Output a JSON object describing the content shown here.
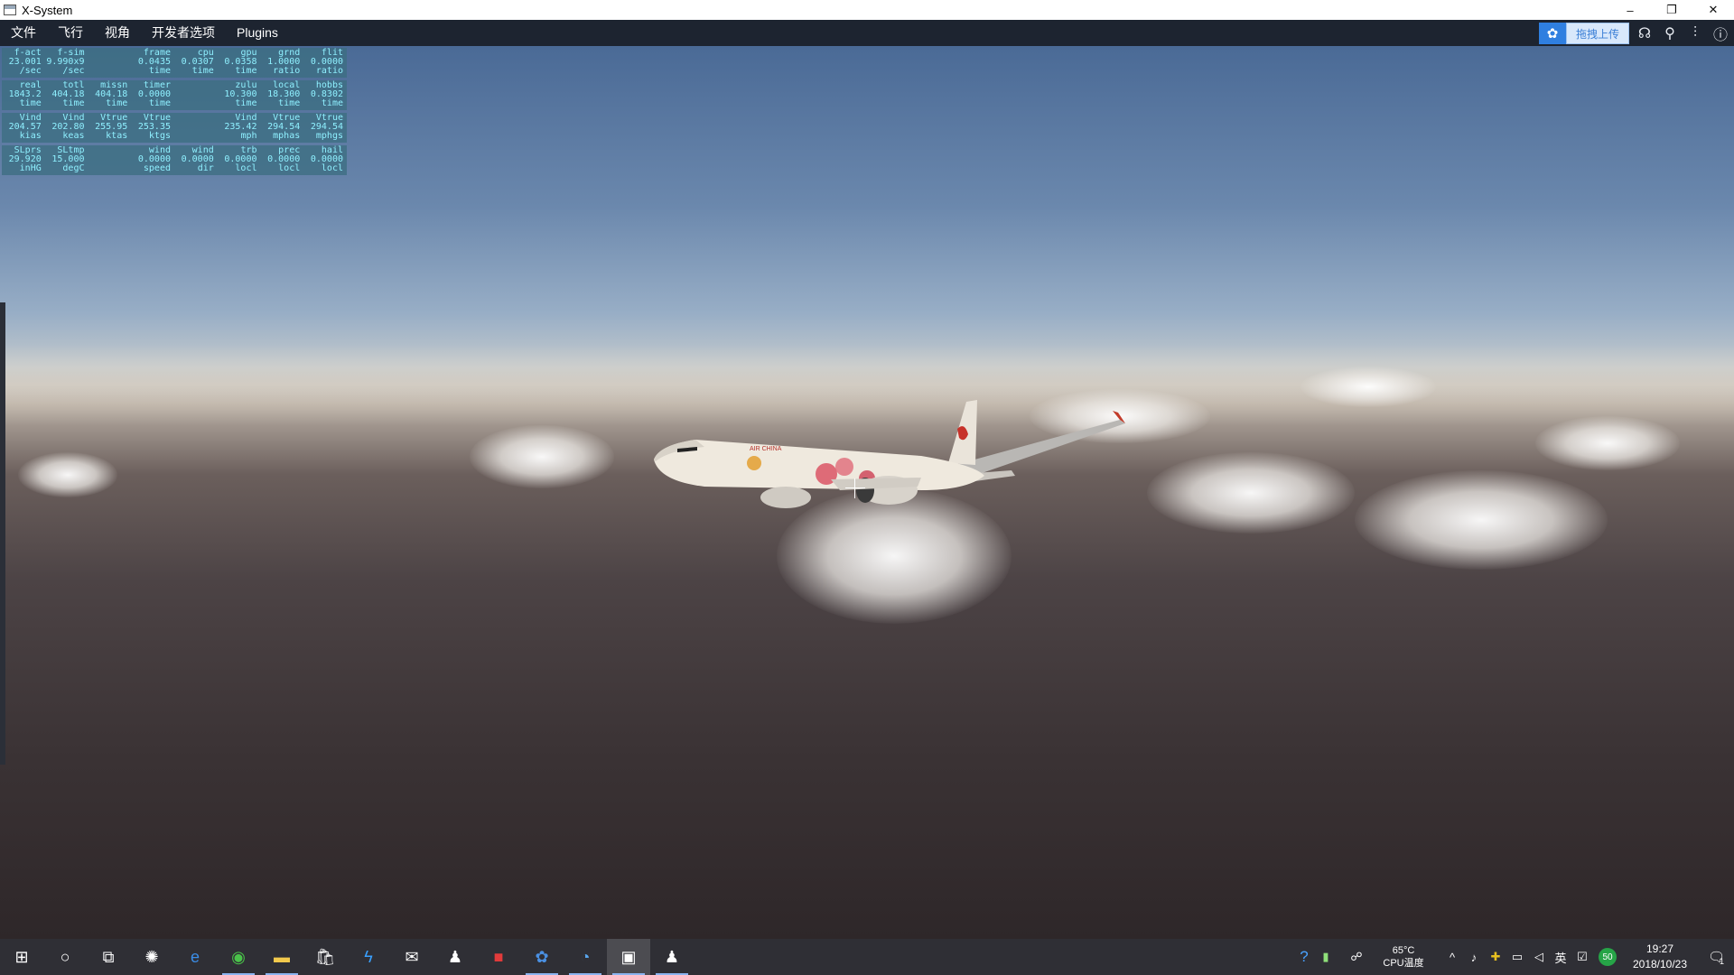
{
  "window": {
    "title": "X-System",
    "minimize": "–",
    "restore": "❐",
    "close": "✕"
  },
  "menu": {
    "items": [
      "文件",
      "飞行",
      "视角",
      "开发者选项",
      "Plugins"
    ]
  },
  "toolbar": {
    "upload_label": "拖拽上传"
  },
  "data_output": {
    "rows": [
      [
        [
          "f-act",
          "23.001",
          "/sec"
        ],
        [
          "f-sim",
          "9.990x9",
          "/sec"
        ],
        [
          "",
          "",
          " "
        ],
        [
          "frame",
          "0.0435",
          "time"
        ],
        [
          "cpu",
          "0.0307",
          "time"
        ],
        [
          "gpu",
          "0.0358",
          "time"
        ],
        [
          "grnd",
          "1.0000",
          "ratio"
        ],
        [
          "flit",
          "0.0000",
          "ratio"
        ]
      ],
      [
        [
          "real",
          "1843.2",
          "time"
        ],
        [
          "totl",
          "404.18",
          "time"
        ],
        [
          "missn",
          "404.18",
          "time"
        ],
        [
          "timer",
          "0.0000",
          "time"
        ],
        [
          "",
          "",
          " "
        ],
        [
          "zulu",
          "10.300",
          "time"
        ],
        [
          "local",
          "18.300",
          "time"
        ],
        [
          "hobbs",
          "0.8302",
          "time"
        ]
      ],
      [
        [
          "Vind",
          "204.57",
          "kias"
        ],
        [
          "Vind",
          "202.80",
          "keas"
        ],
        [
          "Vtrue",
          "255.95",
          "ktas"
        ],
        [
          "Vtrue",
          "253.35",
          "ktgs"
        ],
        [
          "",
          "",
          " "
        ],
        [
          "Vind",
          "235.42",
          "mph"
        ],
        [
          "Vtrue",
          "294.54",
          "mphas"
        ],
        [
          "Vtrue",
          "294.54",
          "mphgs"
        ]
      ],
      [
        [
          "SLprs",
          "29.920",
          "inHG"
        ],
        [
          "SLtmp",
          "15.000",
          "degC"
        ],
        [
          "",
          "",
          " "
        ],
        [
          "wind",
          "0.0000",
          "speed"
        ],
        [
          "wind",
          "0.0000",
          "dir"
        ],
        [
          "trb",
          "0.0000",
          "locl"
        ],
        [
          "prec",
          "0.0000",
          "locl"
        ],
        [
          "hail",
          "0.0000",
          "locl"
        ]
      ]
    ]
  },
  "aircraft": {
    "airline_text": "AIR CHINA"
  },
  "taskbar": {
    "apps": [
      "start-icon",
      "search-circle-icon",
      "task-view-icon",
      "app-settings-icon",
      "edge-icon",
      "browser-360-icon",
      "file-explorer-icon",
      "store-icon",
      "thunder-icon",
      "mail-icon",
      "qq-icon",
      "flash-icon",
      "baidu-netdisk-icon",
      "speed-icon",
      "xplane-icon",
      "qq-icon-2"
    ]
  },
  "tray": {
    "cpu_temp": "65°C",
    "cpu_label": "CPU温度",
    "ime": "英",
    "badge": "50",
    "time": "19:27",
    "date": "2018/10/23",
    "notif_count": "1"
  }
}
